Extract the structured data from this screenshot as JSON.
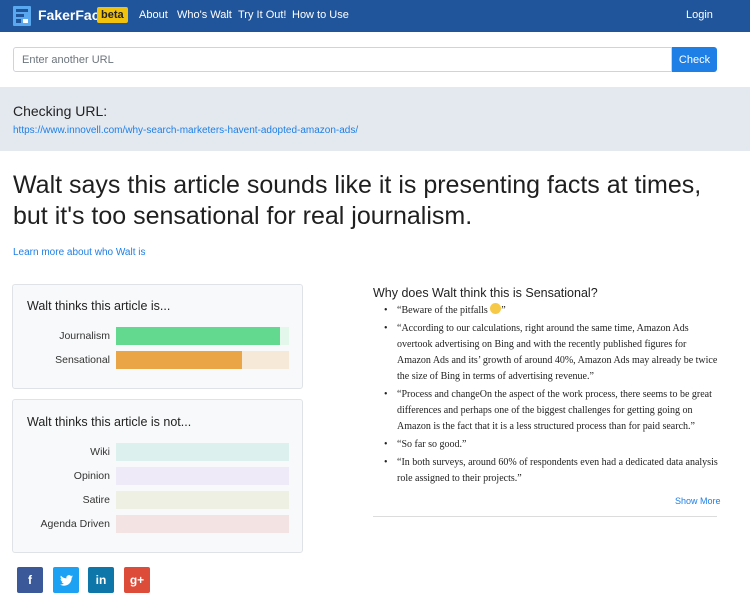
{
  "navbar": {
    "brand": "FakerFact",
    "badge": "beta",
    "links": [
      "About",
      "Who's Walt",
      "Try It Out!",
      "How to Use"
    ],
    "login": "Login"
  },
  "search": {
    "placeholder": "Enter another URL",
    "value": "",
    "button": "Check"
  },
  "checking": {
    "label": "Checking URL:",
    "url": "https://www.innovell.com/why-search-marketers-havent-adopted-amazon-ads/"
  },
  "verdict": {
    "headline": "Walt says this article sounds like it is presenting facts at times, but it's too sensational for real journalism.",
    "learn_more": "Learn more about who Walt is"
  },
  "is_card": {
    "title": "Walt thinks this article is...",
    "bars": [
      {
        "label": "Journalism",
        "fraction": 0.95,
        "fill": "#63d98f",
        "track": "#e3f7ea"
      },
      {
        "label": "Sensational",
        "fraction": 0.73,
        "fill": "#e9a546",
        "track": "#f7e9d8"
      }
    ]
  },
  "not_card": {
    "title": "Walt thinks this article is not...",
    "bars": [
      {
        "label": "Wiki",
        "fraction": 0.0,
        "fill": "#9fded9",
        "track": "#dcf1ee"
      },
      {
        "label": "Opinion",
        "fraction": 0.0,
        "fill": "#cdc4ee",
        "track": "#eeeaf8"
      },
      {
        "label": "Satire",
        "fraction": 0.0,
        "fill": "#d9dcc3",
        "track": "#eff0e4"
      },
      {
        "label": "Agenda Driven",
        "fraction": 0.0,
        "fill": "#ecc7c7",
        "track": "#f4e3e3"
      }
    ]
  },
  "reasons": {
    "title": "Why does Walt think this is Sensational?",
    "items": [
      {
        "text_before": "“Beware of the pitfalls ",
        "text_after": "”",
        "has_emoji": true
      },
      {
        "text_before": "“According to our calculations, right around the same time, Amazon Ads overtook advertising on Bing and with the recently published figures for Amazon Ads and its’ growth of around 40%, Amazon Ads may already be twice the size of Bing in terms of advertising revenue.”",
        "text_after": "",
        "has_emoji": false
      },
      {
        "text_before": "“Process and changeOn the aspect of the work process, there seems to be great differences and perhaps one of the biggest challenges for getting going on Amazon is the fact that it is a less structured process than for paid search.”",
        "text_after": "",
        "has_emoji": false
      },
      {
        "text_before": "“So far so good.”",
        "text_after": "",
        "has_emoji": false
      },
      {
        "text_before": "“In both surveys, around 60% of respondents even had a dedicated data analysis role assigned to their projects.”",
        "text_after": "",
        "has_emoji": false
      }
    ],
    "show_more": "Show More"
  },
  "social": {
    "facebook": "f",
    "twitter": "twitter-bird-icon",
    "linkedin": "in",
    "googleplus": "g+"
  }
}
